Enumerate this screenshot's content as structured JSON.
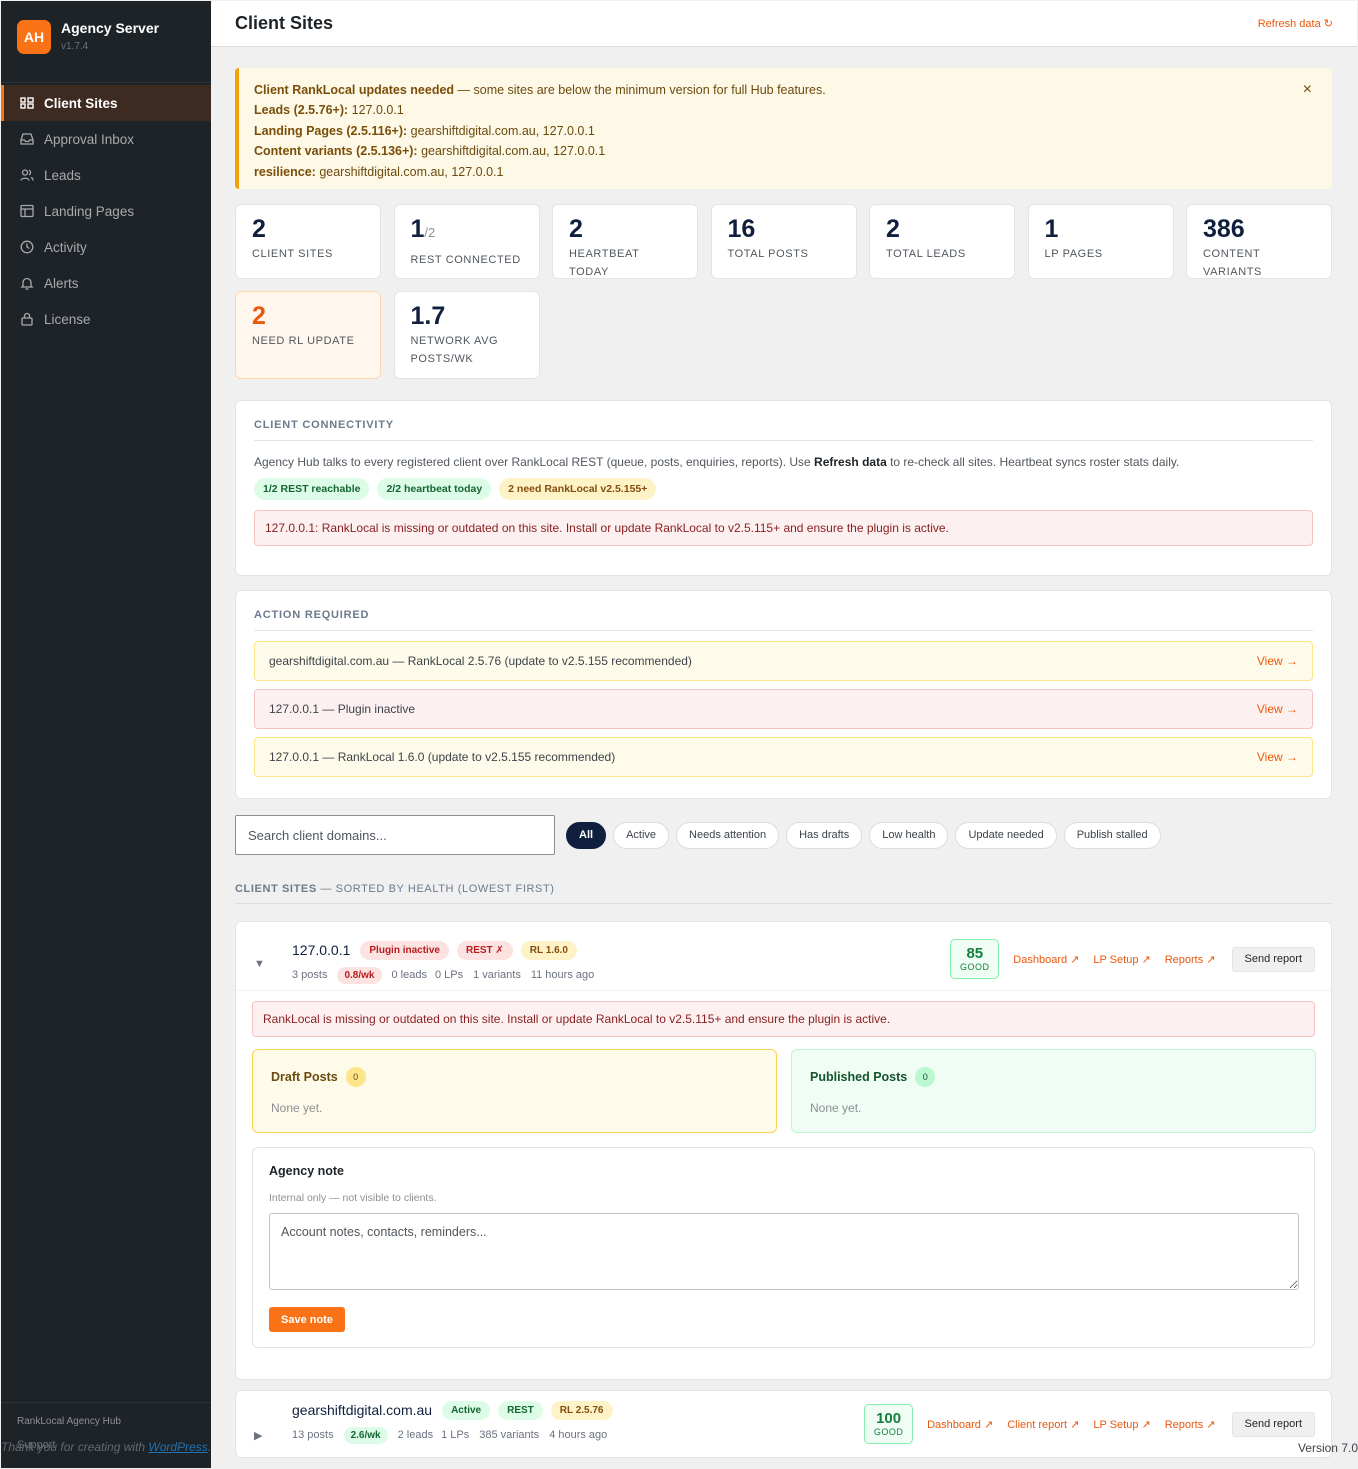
{
  "brand": {
    "badge": "AH",
    "name": "Agency Server",
    "version": "v1.7.4"
  },
  "nav": [
    {
      "label": "Client Sites",
      "icon": "grid-icon",
      "active": true
    },
    {
      "label": "Approval Inbox",
      "icon": "inbox-icon"
    },
    {
      "label": "Leads",
      "icon": "users-icon"
    },
    {
      "label": "Landing Pages",
      "icon": "layout-icon"
    },
    {
      "label": "Activity",
      "icon": "activity-icon"
    },
    {
      "label": "Alerts",
      "icon": "bell-icon"
    },
    {
      "label": "License",
      "icon": "lock-icon"
    }
  ],
  "sidebar_footer": {
    "title": "RankLocal Agency Hub",
    "link": "Support"
  },
  "header": {
    "title": "Client Sites",
    "refresh": "Refresh data ↻"
  },
  "notice": {
    "title": "Client RankLocal updates needed",
    "intro": " — some sites are below the minimum version for full Hub features.",
    "lines": [
      {
        "label": "Leads (2.5.76+):",
        "value": " 127.0.0.1"
      },
      {
        "label": "Landing Pages (2.5.116+):",
        "value": " gearshiftdigital.com.au, 127.0.0.1"
      },
      {
        "label": "Content variants (2.5.136+):",
        "value": " gearshiftdigital.com.au, 127.0.0.1"
      },
      {
        "label": "resilience:",
        "value": " gearshiftdigital.com.au, 127.0.0.1"
      }
    ],
    "close": "×"
  },
  "stats": [
    {
      "num": "2",
      "label": "CLIENT SITES"
    },
    {
      "num": "1",
      "suffix": "/2",
      "label": "REST CONNECTED"
    },
    {
      "num": "2",
      "label": "HEARTBEAT TODAY"
    },
    {
      "num": "16",
      "label": "TOTAL POSTS"
    },
    {
      "num": "2",
      "label": "TOTAL LEADS"
    },
    {
      "num": "1",
      "label": "LP PAGES"
    },
    {
      "num": "386",
      "label": "CONTENT VARIANTS"
    },
    {
      "num": "2",
      "label": "NEED RL UPDATE"
    },
    {
      "num": "1.7",
      "label": "NETWORK AVG POSTS/WK"
    }
  ],
  "connectivity": {
    "heading": "CLIENT CONNECTIVITY",
    "text_pre": "Agency Hub talks to every registered client over RankLocal REST (queue, posts, enquiries, reports). Use ",
    "text_bold": "Refresh data",
    "text_post": " to re-check all sites. Heartbeat syncs roster stats daily.",
    "pills": [
      "1/2 REST reachable",
      "2/2 heartbeat today",
      "2 need RankLocal v2.5.155+"
    ],
    "alert_host": "127.0.0.1:",
    "alert_text": " RankLocal is missing or outdated on this site. Install or update RankLocal to v2.5.115+ and ensure the plugin is active."
  },
  "action_required": {
    "heading": "ACTION REQUIRED",
    "rows": [
      {
        "text": "gearshiftdigital.com.au — RankLocal 2.5.76 (update to v2.5.155 recommended)",
        "link": "View →",
        "tone": "yellow"
      },
      {
        "text": "127.0.0.1 — Plugin inactive",
        "link": "View →",
        "tone": "red"
      },
      {
        "text": "127.0.0.1 — RankLocal 1.6.0 (update to v2.5.155 recommended)",
        "link": "View →",
        "tone": "yellow"
      }
    ]
  },
  "filters": {
    "search_placeholder": "Search client domains...",
    "chips": [
      "All",
      "Active",
      "Needs attention",
      "Has drafts",
      "Low health",
      "Update needed",
      "Publish stalled"
    ]
  },
  "list_heading": {
    "bold": "CLIENT SITES",
    "rest": " — SORTED BY HEALTH (LOWEST FIRST)"
  },
  "site1": {
    "caret": "▼",
    "domain": "127.0.0.1",
    "tags": [
      "Plugin inactive",
      "REST ✗",
      "RL 1.6.0"
    ],
    "posts": "3 posts",
    "rate": "0.8/wk",
    "leads": "0 leads",
    "lps": "0 LPs",
    "variants": "1 variants",
    "ago": "11 hours ago",
    "score": "85",
    "score_label": "GOOD",
    "links": [
      "Dashboard ↗",
      "LP Setup ↗",
      "Reports ↗"
    ],
    "send": "Send report",
    "alert": "RankLocal is missing or outdated on this site. Install or update RankLocal to v2.5.115+ and ensure the plugin is active.",
    "draft_title": "Draft Posts",
    "draft_count": "0",
    "draft_empty": "None yet.",
    "pub_title": "Published Posts",
    "pub_count": "0",
    "pub_empty": "None yet.",
    "note_title": "Agency note",
    "note_sub": "Internal only — not visible to clients.",
    "note_placeholder": "Account notes, contacts, reminders...",
    "note_save": "Save note"
  },
  "site2": {
    "caret": "▶",
    "domain": "gearshiftdigital.com.au",
    "tags": [
      "Active",
      "REST",
      "RL 2.5.76"
    ],
    "posts": "13 posts",
    "rate": "2.6/wk",
    "leads": "2 leads",
    "lps": "1 LPs",
    "variants": "385 variants",
    "ago": "4 hours ago",
    "score": "100",
    "score_label": "GOOD",
    "links": [
      "Dashboard ↗",
      "Client report ↗",
      "LP Setup ↗",
      "Reports ↗"
    ],
    "send": "Send report"
  },
  "wp_footer": {
    "thanks": "Thank you for creating with ",
    "link": "WordPress",
    "dot": ".",
    "version": "Version 7.0"
  }
}
